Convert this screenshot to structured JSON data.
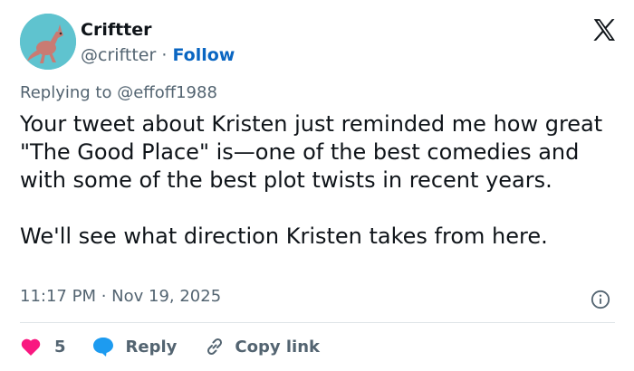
{
  "author": {
    "name": "Criftter",
    "handle": "@criftter",
    "separator": "·",
    "follow_label": "Follow",
    "avatar_bg": "#5fc3cf"
  },
  "brand": {
    "logo_icon": "x-logo-icon"
  },
  "reply_to": {
    "prefix": "Replying to",
    "handle": "@effoff1988"
  },
  "tweet": {
    "text": "Your tweet about Kristen just reminded me how great \"The Good Place\" is—one of the best comedies and with some of the best plot twists in recent years.\n\nWe'll see what direction Kristen takes from here."
  },
  "meta": {
    "timestamp": "11:17 PM · Nov 19, 2025",
    "info_icon": "info-icon"
  },
  "actions": {
    "like_count": "5",
    "like_color": "#f91880",
    "reply_label": "Reply",
    "reply_color": "#1d9bf0",
    "copy_label": "Copy link"
  }
}
